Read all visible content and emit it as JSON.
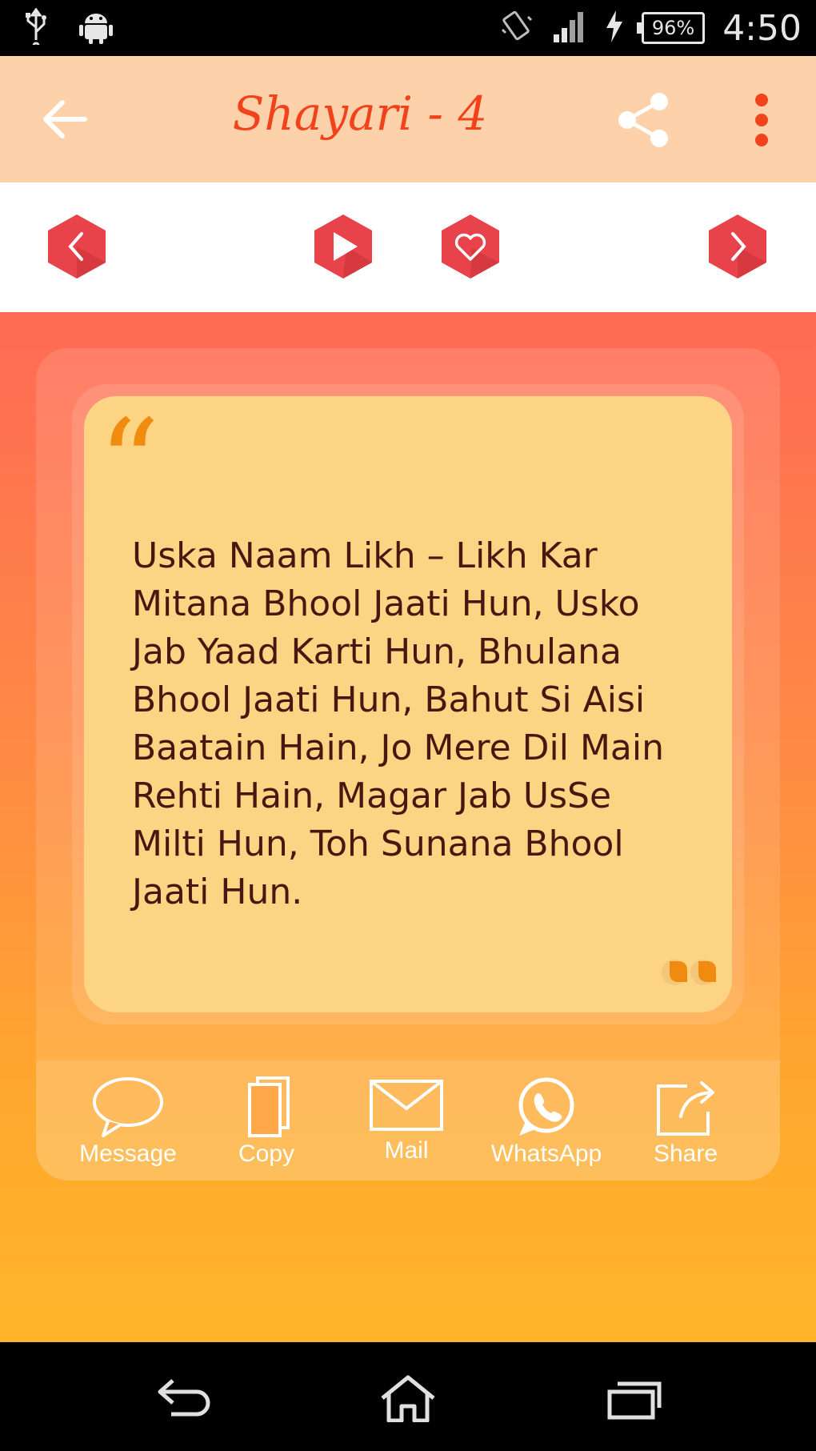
{
  "status_bar": {
    "battery": "96%",
    "time": "4:50",
    "icons": [
      "usb-icon",
      "android-icon",
      "vibrate-icon",
      "signal-icon",
      "charging-icon",
      "battery-icon"
    ]
  },
  "app_bar": {
    "title": "Shayari - 4",
    "icons": [
      "back-arrow-icon",
      "share-icon",
      "more-vert-icon"
    ],
    "title_color": "#f2421c",
    "background": "#fdd1a9"
  },
  "controls": {
    "icons": [
      "previous-icon",
      "play-icon",
      "favorite-icon",
      "next-icon"
    ],
    "accent": "#e8424a"
  },
  "quote": {
    "open_mark": "“",
    "text": "Uska Naam Likh – Likh Kar Mitana Bhool Jaati Hun, Usko Jab Yaad Karti Hun, Bhulana Bhool Jaati Hun, Bahut Si Aisi Baatain Hain, Jo Mere Dil Main Rehti Hain, Magar Jab UsSe Milti Hun, Toh Sunana Bhool Jaati Hun.",
    "card_color": "#fdd483"
  },
  "share_actions": [
    {
      "label": "Message",
      "icon": "message-icon"
    },
    {
      "label": "Copy",
      "icon": "copy-icon"
    },
    {
      "label": "Mail",
      "icon": "mail-icon"
    },
    {
      "label": "WhatsApp",
      "icon": "whatsapp-icon"
    },
    {
      "label": "Share",
      "icon": "share-external-icon"
    }
  ],
  "nav_bar": {
    "icons": [
      "nav-back-icon",
      "nav-home-icon",
      "nav-recents-icon"
    ]
  }
}
